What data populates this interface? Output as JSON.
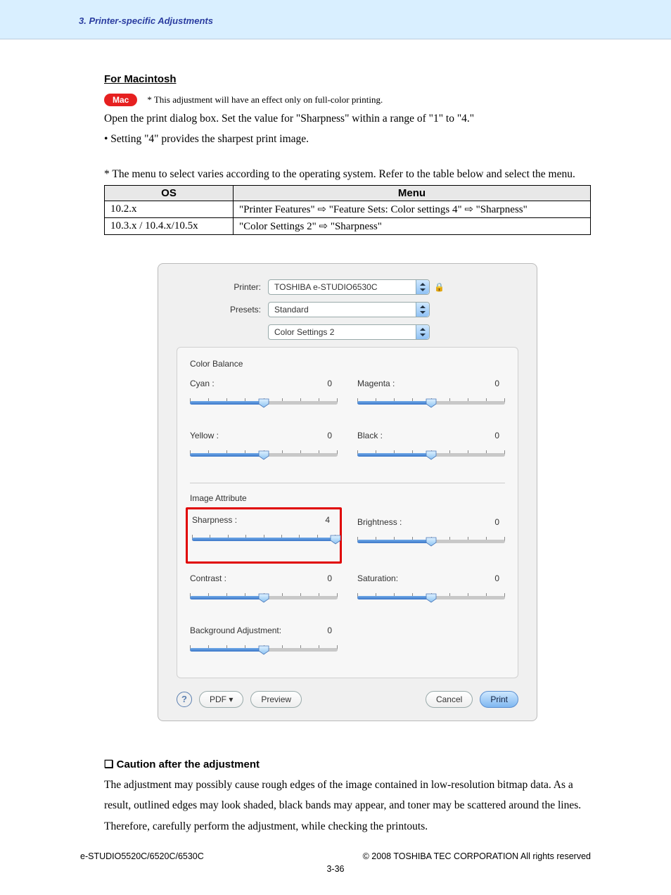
{
  "header": {
    "chapter": "3. Printer-specific Adjustments"
  },
  "mac": {
    "title": "For Macintosh",
    "badge": "Mac",
    "note": "* This adjustment will have an effect only on full-color printing.",
    "para": "Open the print dialog box.  Set the value for \"Sharpness\" within a range of \"1\" to \"4.\"",
    "bullet": "• Setting \"4\" provides the sharpest print image.",
    "tableNote": "* The menu to select varies according to the operating system.  Refer to the table below and select the menu."
  },
  "osTable": {
    "headers": [
      "OS",
      "Menu"
    ],
    "rows": [
      {
        "os": "10.2.x",
        "menu": "\"Printer Features\"  ⇨  \"Feature Sets: Color settings 4\"  ⇨  \"Sharpness\""
      },
      {
        "os": "10.3.x / 10.4.x/10.5x",
        "menu": "\"Color Settings 2\"  ⇨  \"Sharpness\""
      }
    ]
  },
  "dialog": {
    "labels": {
      "printer": "Printer:",
      "presets": "Presets:"
    },
    "printer": "TOSHIBA e-STUDIO6530C",
    "presets": "Standard",
    "pane": "Color Settings 2",
    "section1": "Color Balance",
    "section2": "Image Attribute",
    "sliders": {
      "cyan": {
        "label": "Cyan :",
        "value": "0",
        "pct": 50
      },
      "magenta": {
        "label": "Magenta :",
        "value": "0",
        "pct": 50
      },
      "yellow": {
        "label": "Yellow :",
        "value": "0",
        "pct": 50
      },
      "black": {
        "label": "Black :",
        "value": "0",
        "pct": 50
      },
      "sharpness": {
        "label": "Sharpness :",
        "value": "4",
        "pct": 100
      },
      "brightness": {
        "label": "Brightness :",
        "value": "0",
        "pct": 50
      },
      "contrast": {
        "label": "Contrast :",
        "value": "0",
        "pct": 50
      },
      "saturation": {
        "label": "Saturation:",
        "value": "0",
        "pct": 50
      },
      "bgadj": {
        "label": "Background Adjustment:",
        "value": "0",
        "pct": 50
      }
    },
    "buttons": {
      "pdf": "PDF ▾",
      "preview": "Preview",
      "cancel": "Cancel",
      "print": "Print"
    }
  },
  "caution": {
    "heading": "Caution after the adjustment",
    "body": "The adjustment may possibly cause rough edges of the image contained in low-resolution bitmap data.  As a result, outlined edges may look shaded, black bands may appear, and toner may be scattered around the lines.  Therefore, carefully perform the adjustment, while checking the printouts."
  },
  "footer": {
    "left": "e-STUDIO5520C/6520C/6530C",
    "right": "© 2008 TOSHIBA TEC CORPORATION All rights reserved",
    "page": "3-36"
  }
}
